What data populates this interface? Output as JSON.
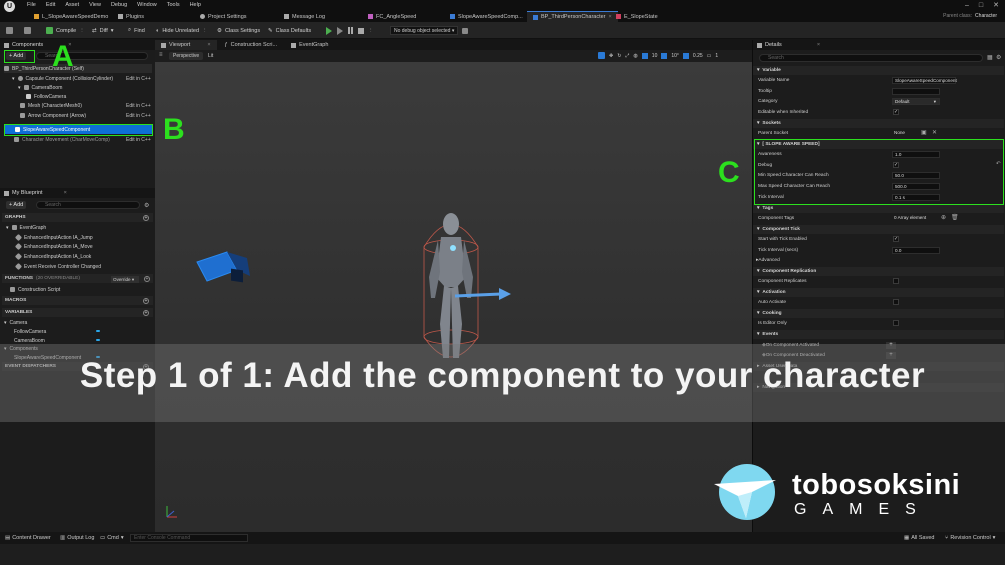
{
  "menu": {
    "items": [
      "File",
      "Edit",
      "Asset",
      "View",
      "Debug",
      "Window",
      "Tools",
      "Help"
    ],
    "logo_glyph": "U"
  },
  "tabs": [
    {
      "label": "L_SlopeAwareSpeedDemo",
      "icon": "level-icon",
      "active": false
    },
    {
      "label": "Plugins",
      "icon": "plugin-icon",
      "active": false
    },
    {
      "label": "Project Settings",
      "icon": "gear-icon",
      "active": false
    },
    {
      "label": "Message Log",
      "icon": "log-icon",
      "active": false
    },
    {
      "label": "FC_AngleSpeed",
      "icon": "curve-icon",
      "active": false
    },
    {
      "label": "SlopeAwareSpeedComp...",
      "icon": "blueprint-icon",
      "active": false
    },
    {
      "label": "BP_ThirdPersonCharacter",
      "icon": "blueprint-icon",
      "active": true
    },
    {
      "label": "E_SlopeState",
      "icon": "enum-icon",
      "active": false
    }
  ],
  "parent_class": {
    "label": "Parent class:",
    "value": "Character"
  },
  "toolbar": {
    "compile": "Compile",
    "diff": "Diff",
    "find": "Find",
    "hide_unrelated": "Hide Unrelated",
    "class_settings": "Class Settings",
    "class_defaults": "Class Defaults",
    "debug_object": "No debug object selected"
  },
  "components": {
    "title": "Components",
    "add_label": "+ Add",
    "search_placeholder": "Search",
    "items": [
      {
        "label": "BP_ThirdPersonCharacter (Self)",
        "edit": ""
      },
      {
        "label": "Capsule Component (CollisionCylinder)",
        "edit": "Edit in C++"
      },
      {
        "label": "CameraBoom",
        "edit": ""
      },
      {
        "label": "FollowCamera",
        "edit": ""
      },
      {
        "label": "Mesh (CharacterMesh0)",
        "edit": "Edit in C++"
      },
      {
        "label": "Arrow Component (Arrow)",
        "edit": "Edit in C++"
      },
      {
        "label": "SlopeAwareSpeedComponent",
        "edit": ""
      },
      {
        "label": "Character Movement (CharMoveComp)",
        "edit": "Edit in C++"
      }
    ]
  },
  "my_blueprint": {
    "title": "My Blueprint",
    "add_label": "+ Add",
    "search_placeholder": "Search",
    "graphs_label": "GRAPHS",
    "event_graph": "EventGraph",
    "events": [
      "EnhancedInputAction IA_Jump",
      "EnhancedInputAction IA_Move",
      "EnhancedInputAction IA_Look",
      "Event Receive Controller Changed"
    ],
    "functions_label": "FUNCTIONS",
    "functions_note": "(20 OVERRIDABLE)",
    "override_label": "Override",
    "construction_script": "Construction Script",
    "macros_label": "MACROS",
    "variables_label": "VARIABLES",
    "camera_group": "Camera",
    "camera_vars": [
      "FollowCamera",
      "CameraBoom"
    ],
    "components_group": "Components",
    "component_vars": [
      "SlopeAwareSpeedComponent"
    ],
    "dispatchers_label": "EVENT DISPATCHERS"
  },
  "viewport": {
    "tabs": [
      "Viewport",
      "Construction Scri...",
      "EventGraph"
    ],
    "perspective": "Perspective",
    "lit": "Lit",
    "grid_snap": "10",
    "rot_snap": "10°",
    "scale_snap": "0.25",
    "camera_speed": "1"
  },
  "details": {
    "title": "Details",
    "search_placeholder": "Search",
    "variable_section": "Variable",
    "variable_rows": [
      {
        "label": "Variable Name",
        "value": "SlopeAwareSpeedComponent"
      },
      {
        "label": "Tooltip",
        "value": ""
      },
      {
        "label": "Category",
        "value": "Default"
      },
      {
        "label": "Editable when Inherited",
        "value": "✓"
      }
    ],
    "sockets_section": "Sockets",
    "parent_socket": {
      "label": "Parent Socket",
      "value": "None"
    },
    "slope_section": "[ SLOPE AWARE SPEED]",
    "slope_rows": [
      {
        "label": "Awareness",
        "value": "1.0"
      },
      {
        "label": "Debug",
        "value": "✓"
      },
      {
        "label": "Min Speed Character Can Reach",
        "value": "50.0"
      },
      {
        "label": "Max Speed Character Can Reach",
        "value": "500.0"
      },
      {
        "label": "Tick Interval",
        "value": "0.1 s"
      }
    ],
    "tags_section": "Tags",
    "component_tags": {
      "label": "Component Tags",
      "value": "0 Array element"
    },
    "tick_section": "Component Tick",
    "tick_rows": [
      {
        "label": "Start with Tick Enabled",
        "value": "✓"
      },
      {
        "label": "Tick Interval (secs)",
        "value": "0.0"
      }
    ],
    "advanced": "Advanced",
    "replication_section": "Component Replication",
    "component_replicates": "Component Replicates",
    "activation_section": "Activation",
    "auto_activate": "Auto Activate",
    "cooking_section": "Cooking",
    "is_editor_only": "Is Editor Only",
    "events_section": "Events",
    "event_rows": [
      "On Component Activated",
      "On Component Deactivated"
    ],
    "asset_user_data": "Asset User Data",
    "navigation": "Navigation"
  },
  "bottom": {
    "content_drawer": "Content Drawer",
    "output_log": "Output Log",
    "cmd": "Cmd",
    "console_placeholder": "Enter Console Command",
    "all_saved": "All Saved",
    "revision_control": "Revision Control"
  },
  "callouts": {
    "a": "A",
    "b": "B",
    "c": "C"
  },
  "banner": "Step 1 of 1: Add the component to your character",
  "brand": {
    "name_top": "tobosoksini",
    "name_bottom": "GAMES",
    "accent": "#7fd8f0"
  },
  "colors": {
    "highlight_green": "#2ce01e",
    "selection_blue": "#0d6fd6",
    "active_tab_accent": "#3a7bd5"
  }
}
